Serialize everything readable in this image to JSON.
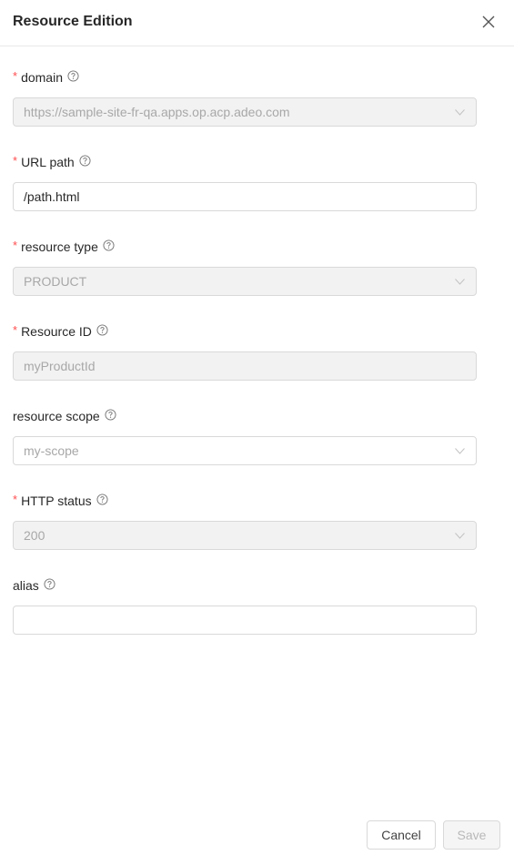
{
  "header": {
    "title": "Resource Edition",
    "close_icon": "close-icon"
  },
  "form": {
    "fields": [
      {
        "label": "domain",
        "required": true,
        "help_icon": "question-circle-icon",
        "type": "select",
        "disabled": true,
        "value": "https://sample-site-fr-qa.apps.op.acp.adeo.com"
      },
      {
        "label": "URL path",
        "required": true,
        "help_icon": "question-circle-icon",
        "type": "input",
        "disabled": false,
        "value": "/path.html"
      },
      {
        "label": "resource type",
        "required": true,
        "help_icon": "question-circle-icon",
        "type": "select",
        "disabled": true,
        "value": "PRODUCT"
      },
      {
        "label": "Resource ID",
        "required": true,
        "help_icon": "question-circle-icon",
        "type": "input",
        "disabled": true,
        "value": "myProductId"
      },
      {
        "label": "resource scope",
        "required": false,
        "help_icon": "question-circle-icon",
        "type": "select",
        "disabled": false,
        "value": "",
        "placeholder": "my-scope"
      },
      {
        "label": "HTTP status",
        "required": true,
        "help_icon": "question-circle-icon",
        "type": "select",
        "disabled": true,
        "value": "200"
      },
      {
        "label": "alias",
        "required": false,
        "help_icon": "question-circle-icon",
        "type": "input",
        "disabled": false,
        "value": ""
      }
    ],
    "required_mark": "*"
  },
  "footer": {
    "cancel_label": "Cancel",
    "save_label": "Save",
    "save_disabled": true
  },
  "colors": {
    "required": "#ff4d4f",
    "border": "#d9d9d9",
    "disabled_bg": "#f2f2f2"
  }
}
